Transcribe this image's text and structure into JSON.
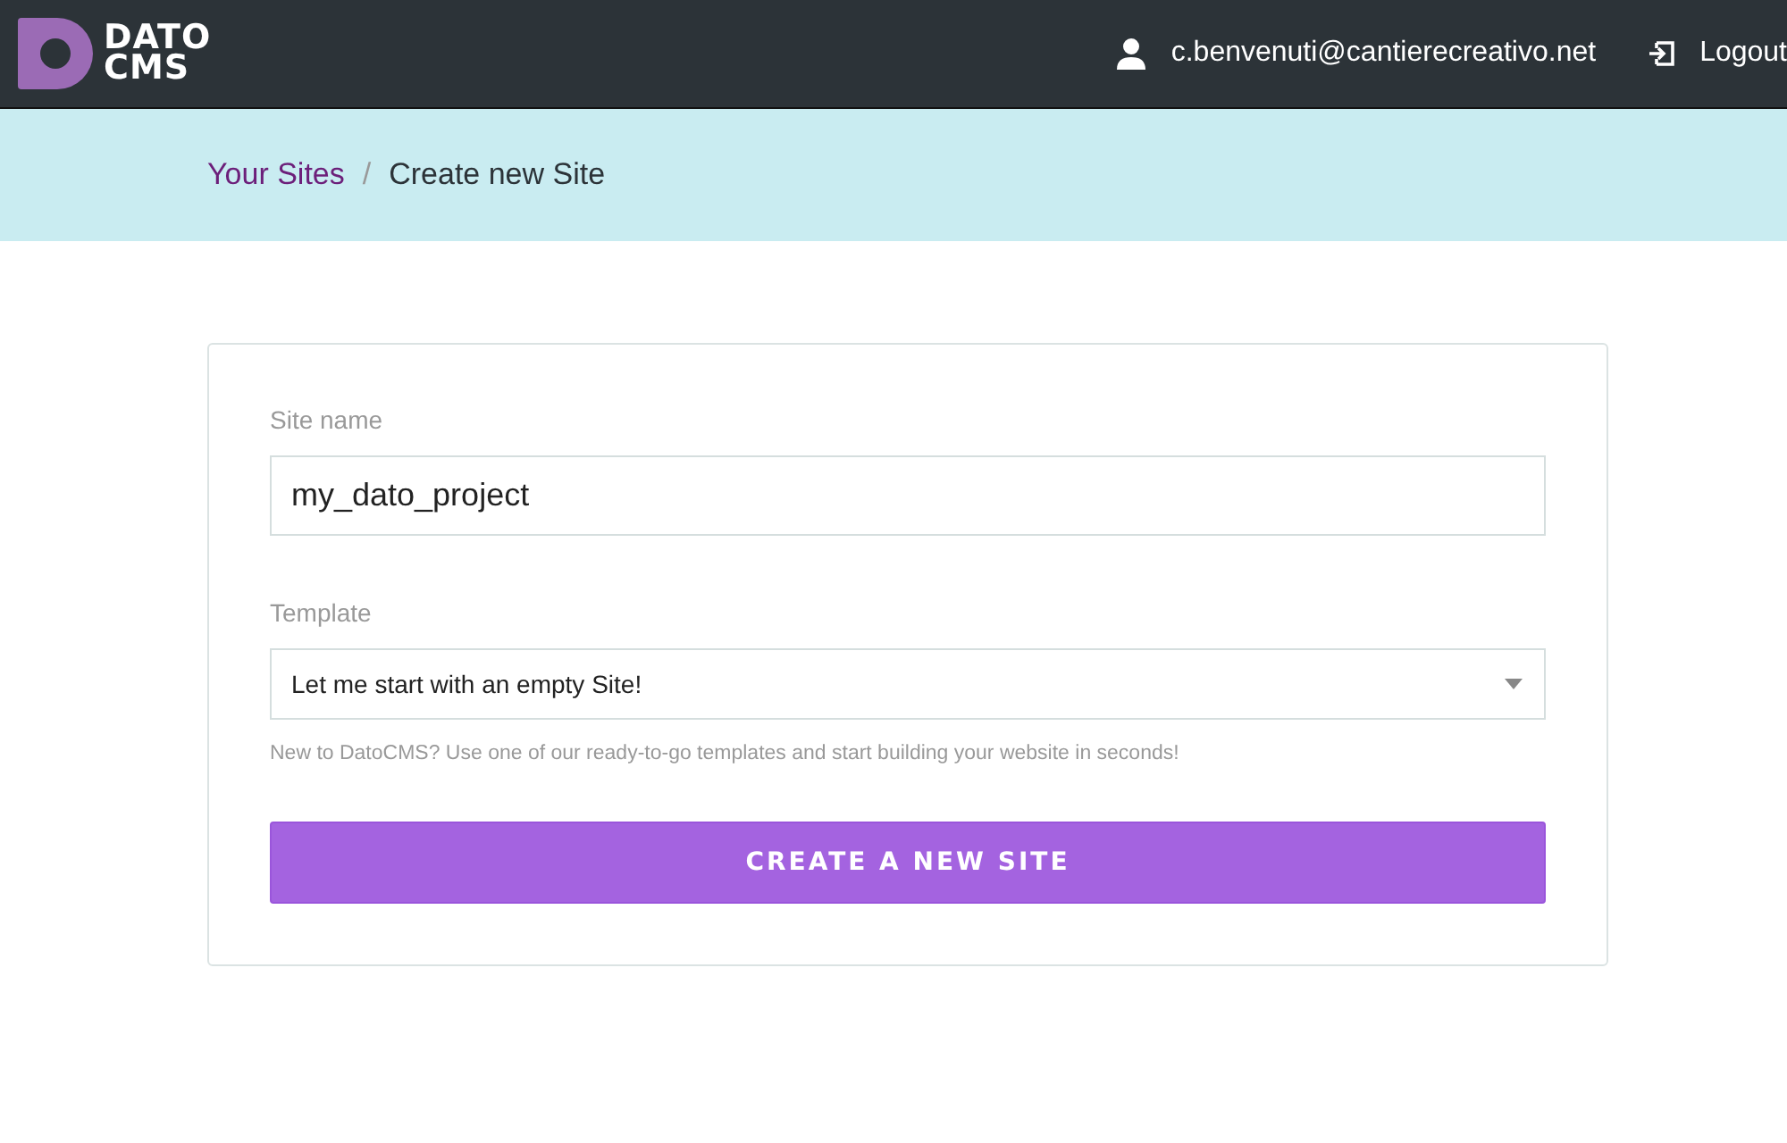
{
  "header": {
    "logo": [
      "DATO",
      "CMS"
    ],
    "user_email": "c.benvenuti@cantierecreativo.net",
    "logout": "Logout"
  },
  "breadcrumb": [
    {
      "label": "Your Sites",
      "kind": "link"
    },
    {
      "label": "Create new Site",
      "kind": "current"
    }
  ],
  "breadcrumb_separator": "/",
  "form": {
    "site_name": {
      "label": "Site name",
      "value": "my_dato_project"
    },
    "template": {
      "label": "Template",
      "value": "Let me start with an empty Site!",
      "hint": "New to DatoCMS? Use one of our ready-to-go templates and start building your website in seconds!"
    },
    "submit": "CREATE A NEW SITE"
  }
}
